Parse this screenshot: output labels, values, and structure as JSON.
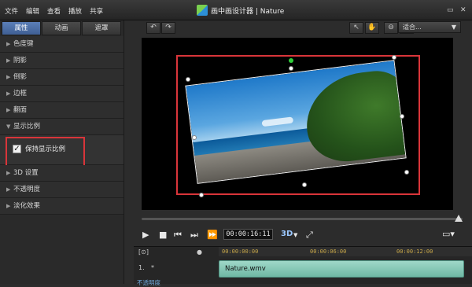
{
  "menu": {
    "items": [
      "文件",
      "编辑",
      "查看",
      "播放",
      "共享"
    ]
  },
  "window": {
    "title": "画中画设计器  |  Nature"
  },
  "tabs": [
    {
      "label": "属性",
      "active": true
    },
    {
      "label": "动画",
      "active": false
    },
    {
      "label": "遮罩",
      "active": false
    }
  ],
  "properties": {
    "top": [
      "色度键",
      "阴影",
      "倒影",
      "边框",
      "翻面",
      "显示比例"
    ],
    "checkbox_label": "保持显示比例",
    "checkbox_checked": true,
    "bottom": [
      "3D 设置",
      "不透明度",
      "淡化效果"
    ]
  },
  "toolbar": {
    "zoom_value": "适合..."
  },
  "playback": {
    "timecode": "00:00:16:11",
    "mode_3d": "3D"
  },
  "timeline": {
    "ruler_marks": [
      "00:00:00:00",
      "00:00:06:00",
      "00:00:12:00"
    ],
    "track_number": "1.",
    "clip_name": "Nature.wmv",
    "opacity_label": "不透明度"
  },
  "colors": {
    "accent_red": "#d9353a",
    "clip_green": "#9fd8c8",
    "active_tab": "#4f73ab"
  }
}
